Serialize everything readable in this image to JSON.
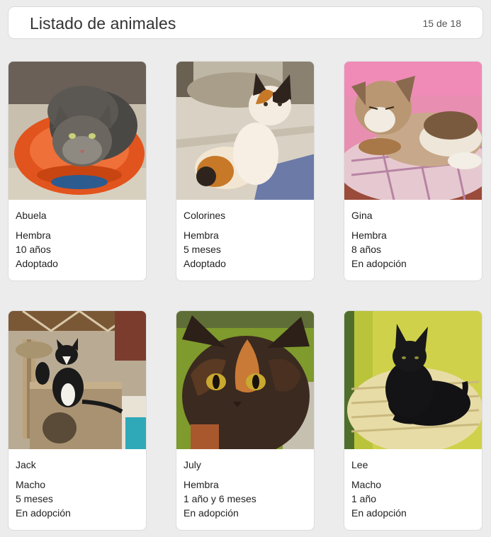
{
  "header": {
    "title": "Listado de animales",
    "count": "15 de 18"
  },
  "animals": [
    {
      "name": "Abuela",
      "sex": "Hembra",
      "age": "10 años",
      "status": "Adoptado"
    },
    {
      "name": "Colorines",
      "sex": "Hembra",
      "age": "5 meses",
      "status": "Adoptado"
    },
    {
      "name": "Gina",
      "sex": "Hembra",
      "age": "8 años",
      "status": "En adopción"
    },
    {
      "name": "Jack",
      "sex": "Macho",
      "age": "5 meses",
      "status": "En adopción"
    },
    {
      "name": "July",
      "sex": "Hembra",
      "age": "1 año y 6 meses",
      "status": "En adopción"
    },
    {
      "name": "Lee",
      "sex": "Macho",
      "age": "1 año",
      "status": "En adopción"
    }
  ]
}
